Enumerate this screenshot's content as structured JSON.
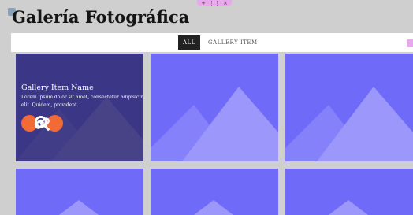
{
  "page": {
    "title": "Galería Fotográfica"
  },
  "editor": {
    "top_handle_glyphs": [
      "+",
      "⋮⋮",
      "×"
    ]
  },
  "filters": {
    "items": [
      {
        "label": "ALL",
        "active": true
      },
      {
        "label": "GALLERY ITEM",
        "active": false
      }
    ]
  },
  "gallery": {
    "hover_item": {
      "name": "Gallery Item Name",
      "description": "Lorem ipsum dolor sit amet, consectetur adipisicing elit. Quidem, provident.",
      "zoom_icon": "zoom-in-icon",
      "link_icon": "link-icon"
    },
    "tile_count": 6,
    "colors": {
      "tile_bg": "#6f6af7",
      "mountain_light": "#9c98fb",
      "mountain_mid": "#8581fa",
      "overlay": "#28235a",
      "button": "#f26a35"
    }
  }
}
